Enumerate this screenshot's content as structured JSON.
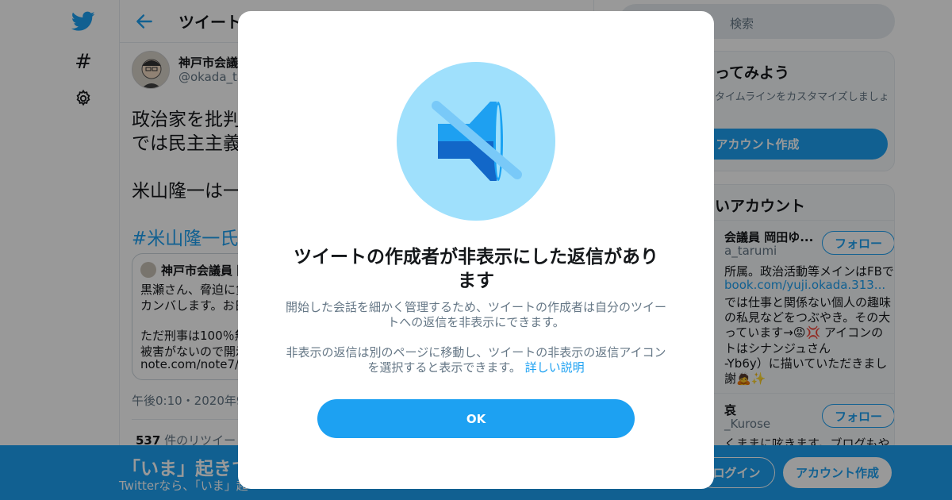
{
  "colors": {
    "accent": "#1da1f2",
    "text": "#14171a",
    "muted": "#657786",
    "overlay": "rgba(0,0,0,0.4)"
  },
  "left_nav": {
    "icons": [
      "twitter-bird-icon",
      "hashtag-icon",
      "settings-gear-icon"
    ],
    "hashtag_glyph": "#"
  },
  "header": {
    "back_icon": "back-arrow-icon",
    "title": "ツイート"
  },
  "tweet": {
    "author_name": "神戸市会議",
    "author_handle": "@okada_ta",
    "text_lines": [
      "政治家を批判",
      "では民主主義",
      "米山隆一は一"
    ],
    "hashtag": "#米山隆一氏の",
    "time": "午後0:10・2020年9月",
    "retweet_count": "537",
    "retweet_label": "件のリツイート"
  },
  "quote": {
    "author": "神戸市会議員 岡",
    "lines": [
      "黒瀬さん、脅迫に負",
      "カンバします。お日",
      "ただ刑事は100％無",
      "被害がないので開示",
      "note.com/note7/n/n"
    ]
  },
  "sidebar": {
    "search_placeholder": "検索",
    "signup_panel": {
      "title": "ってみよう",
      "text": "タイムラインをカスタマイズしましょ",
      "button": "アカウント作成"
    },
    "accounts_panel": {
      "title": "いアカウント",
      "follow_label": "フォロー",
      "accounts": [
        {
          "name": "会議員 岡田ゆ...",
          "handle": "a_tarumi",
          "bio": [
            "所属。政治活動等メインはFBで",
            "book.com/yuji.okada.313...",
            "では仕事と関係ない個人の趣味",
            "の私見などをつぶやき。その大",
            "っています→😡💢 アイコンの",
            "トはシナンジュさん",
            "-Yb6y）に描いていただきまし",
            "謝🙇✨"
          ]
        },
        {
          "name": "哀",
          "handle": "_Kurose",
          "bio": [
            "くままに呟きます。ブログもや"
          ]
        }
      ]
    }
  },
  "bottom_banner": {
    "title": "「いま」起きて",
    "subtitle": "Twitterなら、「いま」起",
    "login": "ログイン",
    "signup": "アカウント作成"
  },
  "modal": {
    "illustration": "muted-speaker-icon",
    "title": "ツイートの作成者が非表示にした返信があります",
    "body_1": "開始した会話を細かく管理するため、ツイートの作成者は自分のツイートへの返信を非表示にできます。",
    "body_2": "非表示の返信は別のページに移動し、ツイートの非表示の返信アイコンを選択すると表示できます。",
    "link_text": "詳しい説明",
    "ok_label": "OK"
  }
}
